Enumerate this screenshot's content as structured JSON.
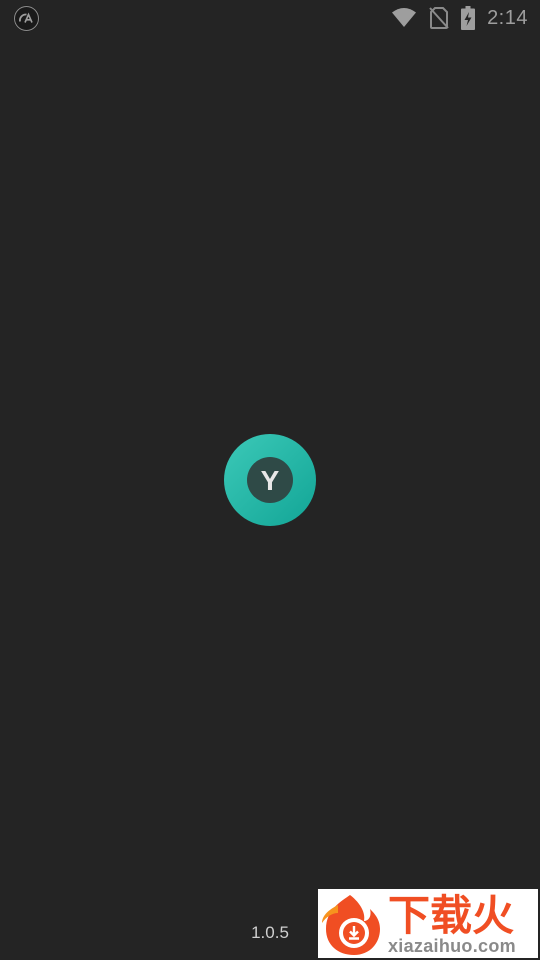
{
  "status_bar": {
    "time": "2:14",
    "left_icon": "cast-badge-icon",
    "right_icons": [
      "wifi-icon",
      "no-sim-icon",
      "battery-charging-icon"
    ],
    "icon_color": "#9e9e9e"
  },
  "splash": {
    "logo_icon": "y-app-logo-icon",
    "logo_letter": "Y",
    "logo_color": "#26b3a6",
    "background_color": "#242424"
  },
  "footer": {
    "version": "1.0.5"
  },
  "watermark": {
    "title": "下载火",
    "url": "xiazaihuo.com",
    "brand_color": "#f04e23"
  }
}
